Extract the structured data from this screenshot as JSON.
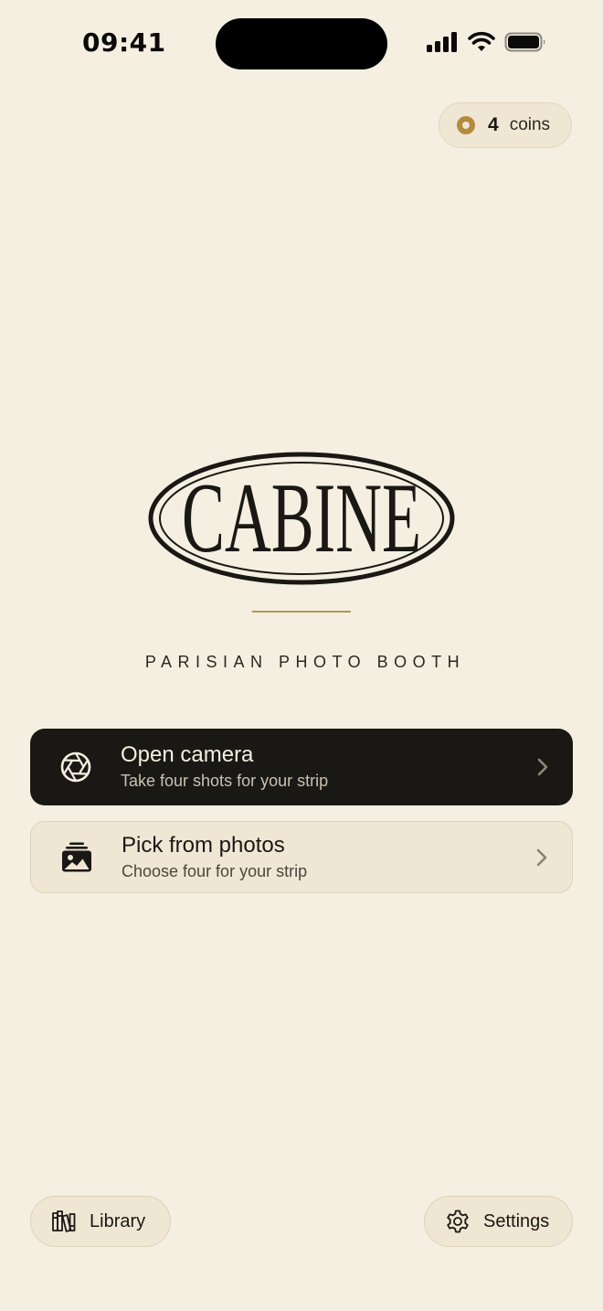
{
  "status_bar": {
    "time": "09:41"
  },
  "coins": {
    "count": "4",
    "label": "coins",
    "accent_color": "#b48a3e"
  },
  "brand": {
    "logo_text": "CABINE",
    "tagline": "PARISIAN PHOTO BOOTH"
  },
  "actions": {
    "camera": {
      "title": "Open camera",
      "subtitle": "Take four shots for your strip",
      "icon": "aperture-icon"
    },
    "photos": {
      "title": "Pick from photos",
      "subtitle": "Choose four for your strip",
      "icon": "photo-stack-icon"
    }
  },
  "bottom_bar": {
    "library_label": "Library",
    "settings_label": "Settings"
  },
  "colors": {
    "background": "#f5efe1",
    "ink": "#1a1814",
    "card_light": "#efe6d4",
    "gold": "#b0955a"
  }
}
